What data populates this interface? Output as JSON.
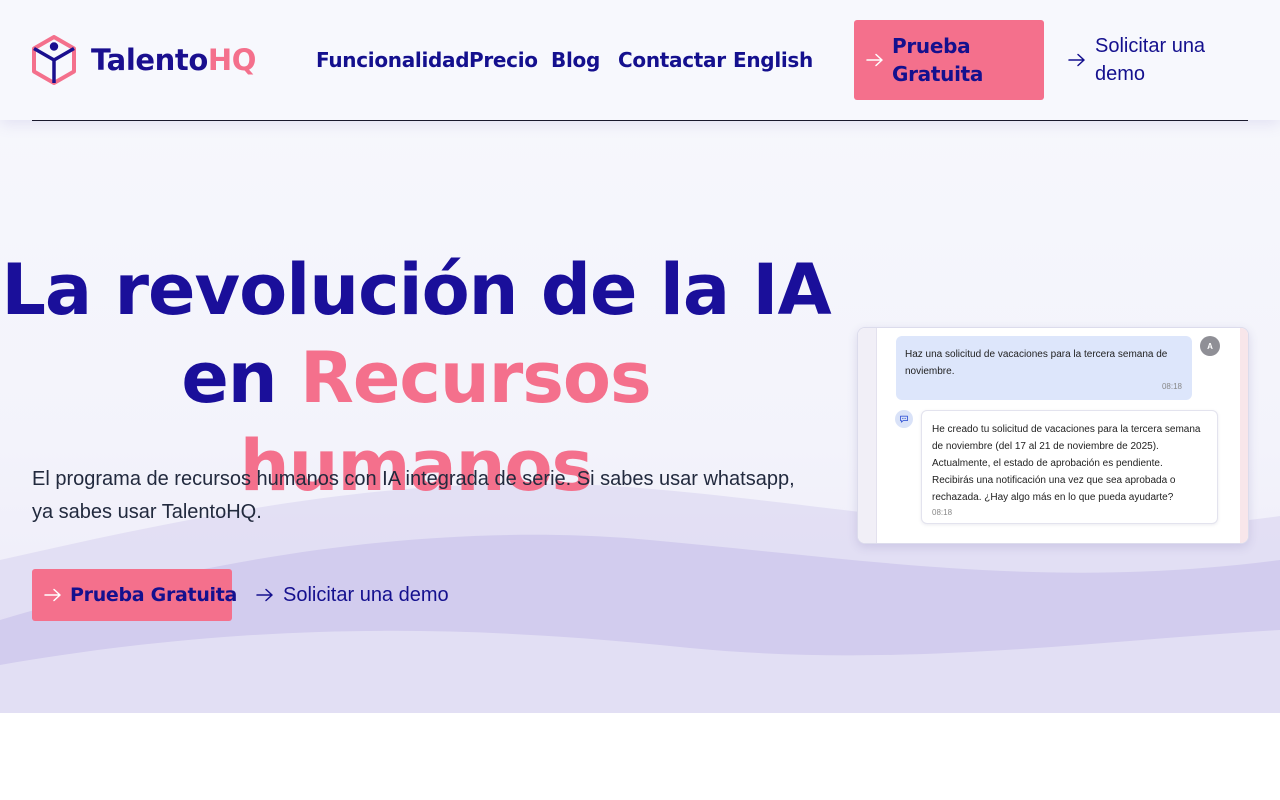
{
  "brand": {
    "name_part1": "Talento",
    "name_part2": "HQ",
    "primary_color": "#1a0f9a",
    "accent_color": "#f4708c"
  },
  "nav": {
    "items": [
      {
        "label": "Funcionalidad"
      },
      {
        "label": "Precio"
      },
      {
        "label": "Blog"
      },
      {
        "label": "Contactar"
      },
      {
        "label": "English"
      }
    ],
    "trial_button": {
      "label_line1": "Prueba",
      "label_line2": "Gratuita",
      "icon": "arrow-right-icon"
    },
    "demo_link": {
      "label_line1": "Solicitar una",
      "label_line2": "demo",
      "icon": "arrow-right-icon"
    }
  },
  "hero": {
    "headline_line1": "La revolución de la IA",
    "headline_line2_plain": "en ",
    "headline_line2_accent": "Recursos humanos",
    "subtext_line1": "El programa de recursos humanos con IA integrada de serie. Si sabes usar whatsapp,",
    "subtext_line2": "ya sabes usar TalentoHQ.",
    "trial_button_label": "Prueba Gratuita",
    "demo_link_label": "Solicitar una demo"
  },
  "chat": {
    "user_message": {
      "text": "Haz una solicitud de vacaciones para la tercera semana de noviembre.",
      "time": "08:18",
      "avatar_initial": "A"
    },
    "bot_message": {
      "text": "He creado tu solicitud de vacaciones para la tercera semana de noviembre (del 17 al 21 de noviembre de 2025). Actualmente, el estado de aprobación es pendiente. Recibirás una notificación una vez que sea aprobada o rechazada. ¿Hay algo más en lo que pueda ayudarte?",
      "time": "08:18",
      "avatar_icon": "chat-bubble-icon"
    }
  }
}
